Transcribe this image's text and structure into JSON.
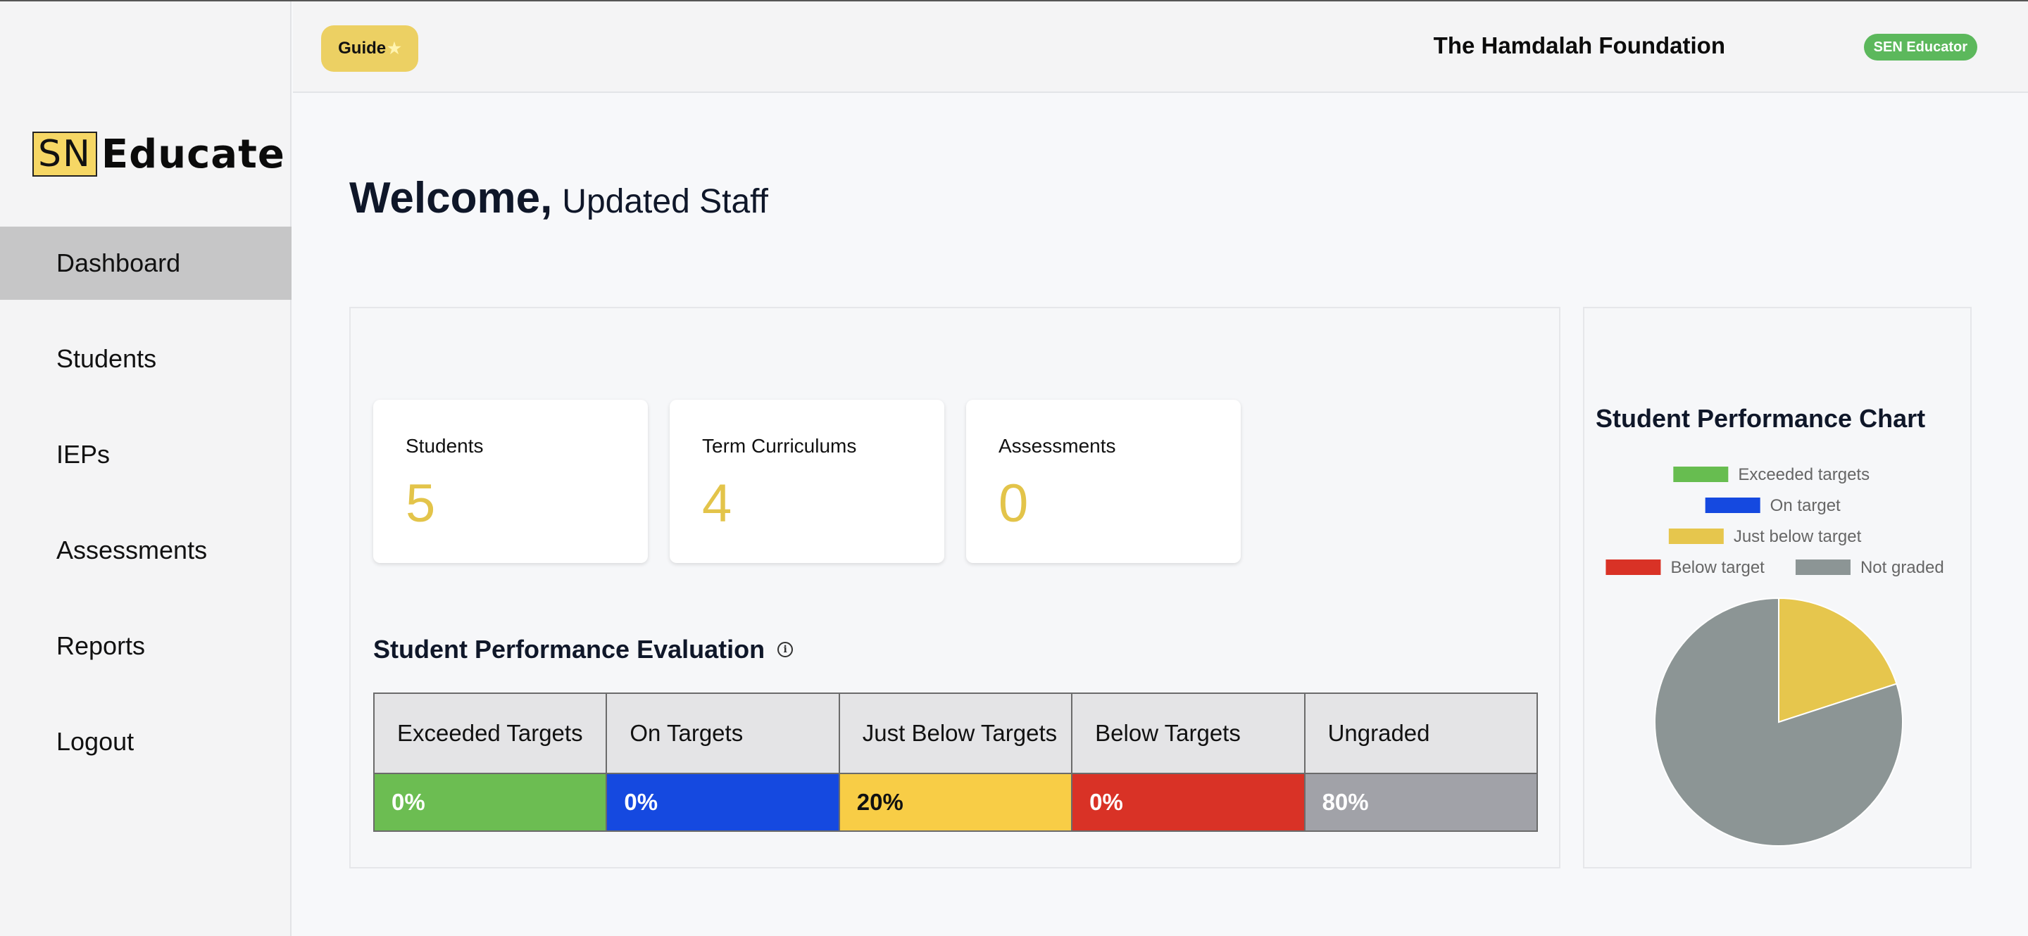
{
  "app": {
    "logo_mark": "SN",
    "logo_text": "Educate"
  },
  "sidebar": {
    "items": [
      {
        "label": "Dashboard",
        "active": true
      },
      {
        "label": "Students"
      },
      {
        "label": "IEPs"
      },
      {
        "label": "Assessments"
      },
      {
        "label": "Reports"
      },
      {
        "label": "Logout"
      }
    ]
  },
  "header": {
    "guide_label": "Guide",
    "guide_icon": "star-icon",
    "organization": "The Hamdalah Foundation",
    "role_badge": "SEN Educator"
  },
  "main": {
    "welcome": "Welcome,",
    "user_name": "Updated Staff",
    "stats": [
      {
        "label": "Students",
        "value": "5"
      },
      {
        "label": "Term Curriculums",
        "value": "4"
      },
      {
        "label": "Assessments",
        "value": "0"
      }
    ],
    "evaluation": {
      "title": "Student Performance Evaluation",
      "columns": [
        {
          "header": "Exceeded Targets",
          "value": "0%",
          "color": "#6cbd52",
          "text_color": "#ffffff"
        },
        {
          "header": "On Targets",
          "value": "0%",
          "color": "#1549e0",
          "text_color": "#ffffff"
        },
        {
          "header": "Just Below Targets",
          "value": "20%",
          "color": "#f8cd46",
          "text_color": "#111111"
        },
        {
          "header": "Below Targets",
          "value": "0%",
          "color": "#d93226",
          "text_color": "#ffffff"
        },
        {
          "header": "Ungraded",
          "value": "80%",
          "color": "#a1a2a8",
          "text_color": "#ffffff"
        }
      ]
    }
  },
  "chart_data": {
    "type": "pie",
    "title": "Student Performance Chart",
    "legend_position": "top",
    "categories": [
      "Exceeded targets",
      "On target",
      "Just below target",
      "Below target",
      "Not graded"
    ],
    "values": [
      0,
      0,
      20,
      0,
      80
    ],
    "colors": [
      "#67bd50",
      "#1549e0",
      "#e6c64d",
      "#d93226",
      "#8c9595"
    ]
  }
}
